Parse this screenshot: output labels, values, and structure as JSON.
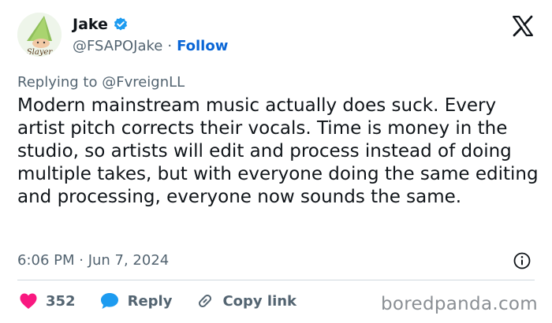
{
  "author": {
    "display_name": "Jake",
    "handle": "@FSAPOJake",
    "separator": "·",
    "follow_label": "Follow",
    "verified": true,
    "avatar_caption": "Slayer"
  },
  "reply": {
    "prefix": "Replying to",
    "target": "@FvreignLL"
  },
  "tweet": {
    "text": "Modern mainstream music actually does suck. Every artist pitch corrects their vocals. Time is money in the studio, so artists will edit and process instead of doing multiple takes, but with everyone doing the same editing and processing, everyone now sounds the same.",
    "timestamp": "6:06 PM · Jun 7, 2024"
  },
  "actions": {
    "likes_count": "352",
    "reply_label": "Reply",
    "copy_link_label": "Copy link"
  },
  "watermark": "boredpanda.com",
  "colors": {
    "accent": "#0a66d6",
    "like": "#f91880",
    "text_primary": "#0f1419",
    "text_secondary": "#536471",
    "verified": "#1d9bf0"
  },
  "icons": {
    "platform_logo": "x-logo-icon",
    "verified": "verified-badge-icon",
    "info": "info-icon",
    "like": "heart-icon",
    "reply": "reply-bubble-icon",
    "copy_link": "link-icon"
  }
}
